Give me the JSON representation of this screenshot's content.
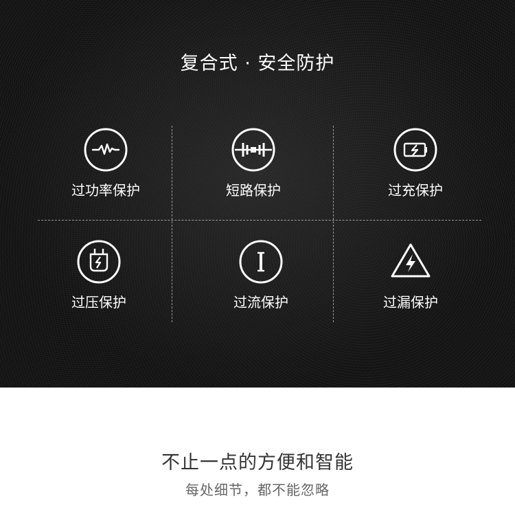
{
  "protection": {
    "title": "复合式 · 安全防护",
    "items": [
      {
        "label": "过功率保护",
        "icon": "overpower-pulse-icon"
      },
      {
        "label": "短路保护",
        "icon": "short-circuit-icon"
      },
      {
        "label": "过充保护",
        "icon": "battery-charge-icon"
      },
      {
        "label": "过压保护",
        "icon": "plug-voltage-icon"
      },
      {
        "label": "过流保护",
        "icon": "current-bar-icon"
      },
      {
        "label": "过漏保护",
        "icon": "warning-lightning-icon"
      }
    ]
  },
  "footer": {
    "headline": "不止一点的方便和智能",
    "subline": "每处细节，都不能忽略"
  }
}
